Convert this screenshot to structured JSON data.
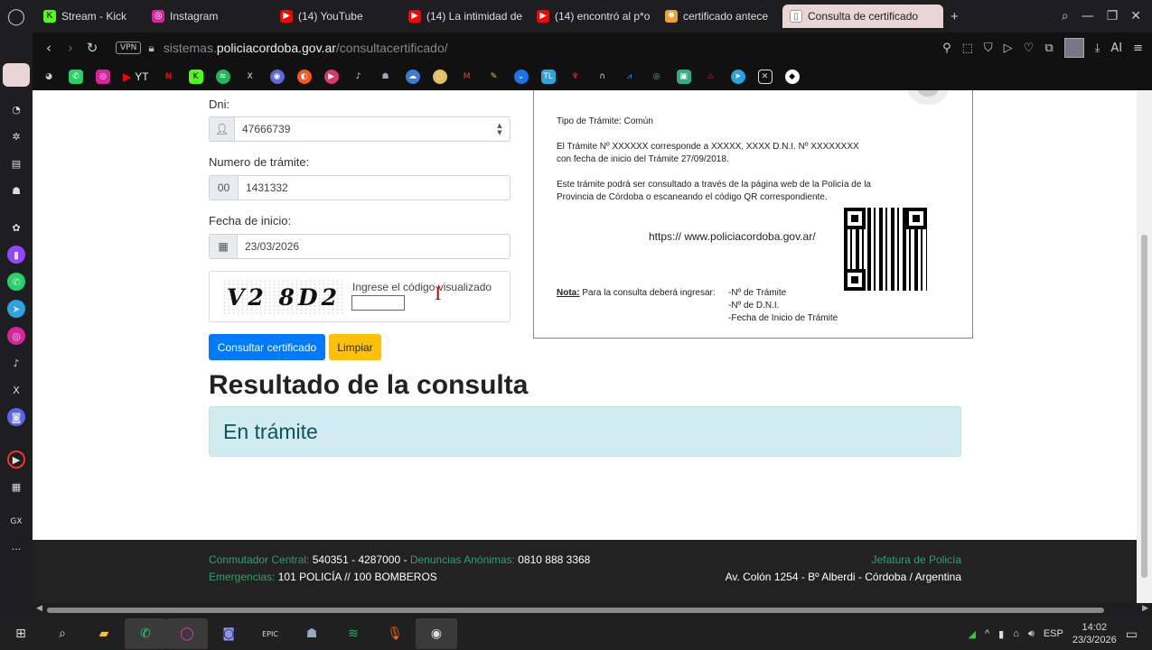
{
  "browser": {
    "tabs": [
      {
        "label": "Stream - Kick Dash",
        "icon": "kick-icon",
        "color": "#53fc18"
      },
      {
        "label": "Instagram",
        "icon": "instagram-icon",
        "color": "#d6249f"
      },
      {
        "label": "(14) YouTube",
        "icon": "youtube-icon",
        "color": "#ff0000"
      },
      {
        "label": "(14) La intimidad de",
        "icon": "youtube-icon",
        "color": "#ff0000"
      },
      {
        "label": "(14) encontró al p*o",
        "icon": "youtube-icon",
        "color": "#ff0000"
      },
      {
        "label": "certificado antece",
        "icon": "gear-icon",
        "color": "#f0a030"
      },
      {
        "label": "Consulta de certificado",
        "icon": "page-icon",
        "color": "#999999"
      }
    ],
    "vpn_label": "VPN",
    "url_prefix": "sistemas.",
    "url_domain": "policiacordoba.gov.ar",
    "url_path": "/consultacertificado/",
    "ai_label": "AI",
    "bookmark_yt": "YT"
  },
  "form": {
    "dni_label": "Dni:",
    "dni_value": "47666739",
    "tramite_label": "Numero de trámite:",
    "tramite_prefix": "00",
    "tramite_value": "1431332",
    "fecha_label": "Fecha de inicio:",
    "fecha_value": "23/03/2026",
    "captcha_text": "V2 8D2",
    "captcha_label": "Ingrese el código visualizado",
    "submit_label": "Consultar certificado",
    "clear_label": "Limpiar"
  },
  "result": {
    "title": "Resultado de la consulta",
    "status": "En trámite",
    "status_color": "#d1ecf1"
  },
  "certificate": {
    "tipo": "Tipo de Trámite: Común",
    "line1": "El Trámite Nº XXXXXX corresponde a XXXXX, XXXX D.N.I. Nº XXXXXXXX",
    "line2": "con fecha de inicio del Trámite 27/09/2018.",
    "line3": "Este trámite podrá ser consultado a través de la página web de la Policía de la",
    "line4": "Provincia de Córdoba o escaneando el código QR correspondiente.",
    "web": "https:// www.policiacordoba.gov.ar/",
    "nota_label": "Nota:",
    "nota_text": "Para la consulta deberá ingresar:",
    "nota_items": [
      "-Nº de Trámite",
      "-Nº de D.N.I.",
      "-Fecha de Inicio de Trámite"
    ]
  },
  "footer": {
    "conmutador_label": "Conmutador Central:",
    "conmutador_value": "540351 - 4287000 -",
    "denuncias_label": "Denuncias Anónimas:",
    "denuncias_value": "0810 888 3368",
    "emergencias_label": "Emergencias:",
    "emergencias_value": "101 POLICÍA // 100 BOMBEROS",
    "jefatura": "Jefatura de Policía",
    "address": "Av. Colón 1254 - Bº Alberdi - Córdoba / Argentina",
    "accent": "#33a06b"
  },
  "taskbar": {
    "language": "ESP",
    "time": "14:02",
    "date": "23/3/2026"
  }
}
